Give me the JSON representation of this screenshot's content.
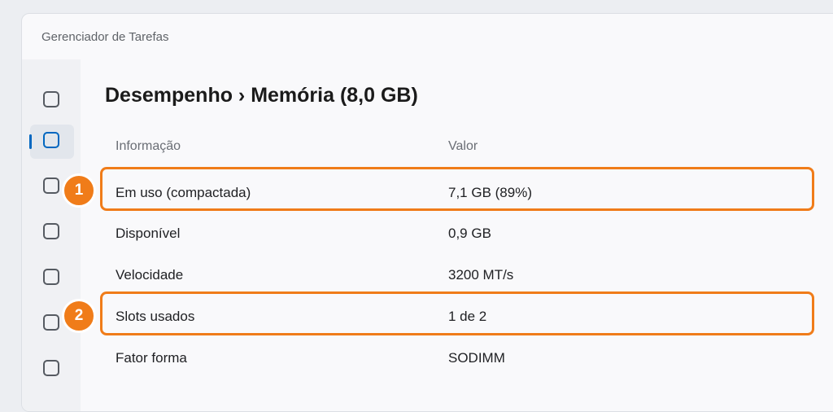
{
  "window": {
    "title": "Gerenciador de Tarefas"
  },
  "nav": {
    "items": [
      {
        "icon": "square-icon",
        "active": false
      },
      {
        "icon": "square-icon",
        "active": true
      },
      {
        "icon": "square-icon",
        "active": false
      },
      {
        "icon": "square-icon",
        "active": false
      },
      {
        "icon": "square-icon",
        "active": false
      },
      {
        "icon": "square-icon",
        "active": false
      },
      {
        "icon": "square-icon",
        "active": false
      }
    ]
  },
  "main": {
    "heading": "Desempenho › Memória (8,0 GB)",
    "columns": {
      "info": "Informação",
      "value": "Valor"
    },
    "rows": [
      {
        "label": "Em uso (compactada)",
        "value": "7,1 GB (89%)"
      },
      {
        "label": "Disponível",
        "value": "0,9 GB"
      },
      {
        "label": "Velocidade",
        "value": "3200 MT/s"
      },
      {
        "label": "Slots usados",
        "value": "1 de 2"
      },
      {
        "label": "Fator forma",
        "value": "SODIMM"
      }
    ]
  },
  "annotations": [
    {
      "number": "1"
    },
    {
      "number": "2"
    }
  ],
  "colors": {
    "accent": "#0067c0",
    "highlight": "#f07c19"
  }
}
